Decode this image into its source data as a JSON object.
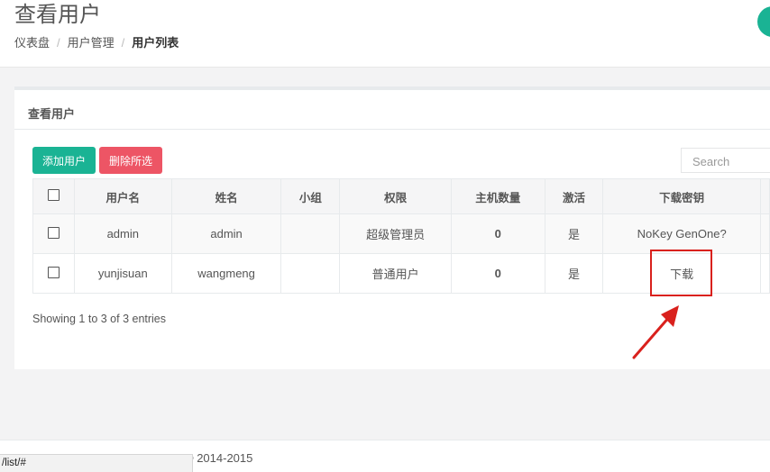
{
  "header": {
    "title": "查看用户",
    "breadcrumb": [
      "仪表盘",
      "用户管理",
      "用户列表"
    ],
    "separator": "/"
  },
  "panel": {
    "title": "查看用户",
    "add_label": "添加用户",
    "delete_label": "删除所选",
    "search_placeholder": "Search"
  },
  "table": {
    "columns": [
      "用户名",
      "姓名",
      "小组",
      "权限",
      "主机数量",
      "激活",
      "下载密钥"
    ],
    "rows": [
      {
        "username": "admin",
        "name": "admin",
        "group": "",
        "role": "超级管理员",
        "hosts": "0",
        "active": "是",
        "key": "NoKey GenOne?"
      },
      {
        "username": "yunjisuan",
        "name": "wangmeng",
        "group": "",
        "role": "普通用户",
        "hosts": "0",
        "active": "是",
        "key": "下载"
      }
    ]
  },
  "pagination": {
    "info": "Showing 1 to 3 of 3 entries"
  },
  "footer": {
    "copyright": "© 2014-2015"
  },
  "statusbar": {
    "url": "/list/#"
  },
  "colors": {
    "primary": "#1ab394",
    "danger": "#ed5565",
    "link": "#337ab7",
    "annotation": "#d9211d"
  }
}
